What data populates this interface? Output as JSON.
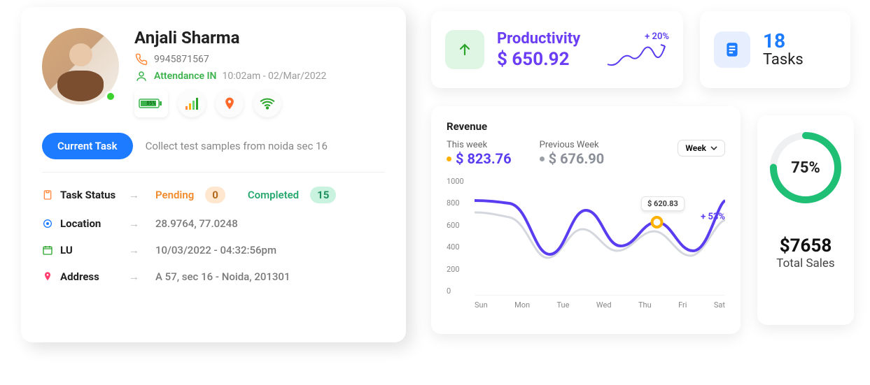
{
  "profile": {
    "name": "Anjali Sharma",
    "phone": "9945871567",
    "attendance_label": "Attendance IN",
    "attendance_time": "10:02am - 02/Mar/2022",
    "battery_pct": "85%",
    "current_task_button": "Current Task",
    "current_task_text": "Collect test samples from noida sec 16",
    "task_status_label": "Task Status",
    "pending_label": "Pending",
    "pending_count": "0",
    "completed_label": "Completed",
    "completed_count": "15",
    "location_label": "Location",
    "location_value": "28.9764, 77.0248",
    "lu_label": "LU",
    "lu_value": "10/03/2022  -  04:32:56pm",
    "address_label": "Address",
    "address_value": "A 57, sec 16 - Noida, 201301"
  },
  "productivity": {
    "title": "Productivity",
    "amount": "$ 650.92",
    "change": "+ 20%"
  },
  "tasks": {
    "count": "18",
    "label": "Tasks"
  },
  "revenue": {
    "title": "Revenue",
    "this_week_label": "This week",
    "this_week_value": "$ 823.76",
    "prev_week_label": "Previous Week",
    "prev_week_value": "$ 676.90",
    "selector": "Week",
    "change_pct": "+ 53%",
    "tooltip_value": "$ 620.83"
  },
  "sales": {
    "pct": "75%",
    "amount": "$7658",
    "label": "Total Sales"
  },
  "chart_data": {
    "type": "line",
    "title": "Revenue",
    "xlabel": "",
    "ylabel": "",
    "ylim": [
      0,
      1000
    ],
    "yticks": [
      0,
      200,
      400,
      600,
      800,
      1000
    ],
    "categories": [
      "Sun",
      "Mon",
      "Tue",
      "Wed",
      "Thu",
      "Fri",
      "Sat"
    ],
    "series": [
      {
        "name": "This week",
        "color": "#5a3df0",
        "values": [
          800,
          780,
          350,
          720,
          420,
          620,
          380,
          800
        ]
      },
      {
        "name": "Previous Week",
        "color": "#d4d7dd",
        "values": [
          700,
          680,
          320,
          560,
          380,
          540,
          340,
          640
        ]
      }
    ],
    "highlight": {
      "category": "Thu",
      "value": 620.83
    },
    "legend_position": "top",
    "grid": false
  }
}
